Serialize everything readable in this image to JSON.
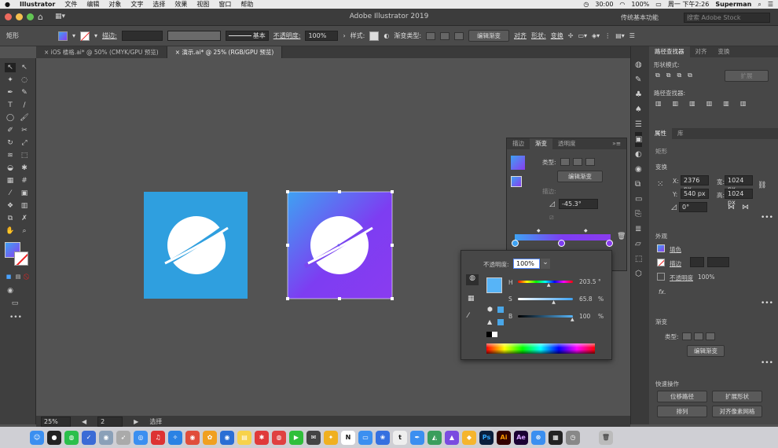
{
  "menubar": {
    "apple": "",
    "app": "Illustrator",
    "items": [
      "文件",
      "编辑",
      "对象",
      "文字",
      "选择",
      "效果",
      "视图",
      "窗口",
      "帮助"
    ],
    "battery": "100%",
    "time_status": "30:00",
    "datetime": "周一 下午2:26",
    "user": "Superman"
  },
  "appbar": {
    "title": "Adobe Illustrator 2019",
    "workspace": "传统基本功能",
    "search_placeholder": "搜索 Adobe Stock"
  },
  "control_bar": {
    "shape_name": "矩形",
    "stroke_label": "描边:",
    "stroke_style": "基本",
    "opacity_label": "不透明度:",
    "opacity_value": "100%",
    "style_label": "样式:",
    "gradient_type_label": "渐变类型:",
    "edit_gradient": "编辑渐变",
    "align": "对齐",
    "shape": "形状:",
    "transform": "变换"
  },
  "doc_tabs": [
    {
      "label": "iOS 楼格.ai* @ 50% (CMYK/GPU 预览)",
      "active": false
    },
    {
      "label": "演示.ai* @ 25% (RGB/GPU 预览)",
      "active": true
    }
  ],
  "status": {
    "zoom": "25%",
    "page": "2",
    "tool": "选择"
  },
  "gradient_panel": {
    "tabs": [
      "描边",
      "渐变",
      "透明度"
    ],
    "type_label": "类型:",
    "edit_button": "编辑渐变",
    "stroke_label": "描边:",
    "angle": "-45.3°"
  },
  "color_popup": {
    "opacity_label": "不透明度:",
    "opacity_value": "100%",
    "h_label": "H",
    "h_value": "203.5",
    "h_unit": "°",
    "h_fraction": 0.57,
    "s_label": "S",
    "s_value": "65.8",
    "s_unit": "%",
    "s_fraction": 0.66,
    "b_label": "B",
    "b_value": "100",
    "b_unit": "%",
    "b_fraction": 1.0,
    "swatch_color": "#57b4f7"
  },
  "right_panel": {
    "top_tabs": [
      "路径查找器",
      "对齐",
      "变换"
    ],
    "shape_modes": "形状模式:",
    "expand": "扩展",
    "pathfinder": "路径查找器:",
    "prop_tabs": [
      "属性",
      "库"
    ],
    "rect_label": "矩形",
    "transform_label": "变换",
    "x_label": "X:",
    "x_value": "2376 px",
    "w_label": "宽:",
    "w_value": "1024 px",
    "y_label": "Y:",
    "y_value": "540 px",
    "h_label": "高:",
    "h_value": "1024 px",
    "rotate_value": "0°",
    "appearance_label": "外观",
    "fill_label": "填色",
    "stroke_label": "描边",
    "opacity_label": "不透明度",
    "opacity_value": "100%",
    "fx": "fx.",
    "gradient_label": "渐变",
    "type_label": "类型:",
    "edit_gradient": "编辑渐变",
    "quick_actions": "快速操作",
    "offset_path": "位移路径",
    "expand_shape": "扩展形状",
    "arrange": "排列",
    "pixel_align": "对齐像素网格"
  },
  "colors": {
    "icon_blue": "#2f9fdf",
    "grad_start": "#3ea2f2",
    "grad_mid": "#7d3df2",
    "grad_end": "#8a3cf0"
  },
  "dock_icons": [
    "finder-icon",
    "qq-icon",
    "wechat-icon",
    "tasks-icon",
    "launchpad-icon",
    "rocket-icon",
    "chrome-icon",
    "netease-music-icon",
    "safari-icon",
    "google-chrome-icon",
    "photos-icon",
    "camera-icon",
    "notes-icon",
    "app-store-icon",
    "preview-icon",
    "iqiyi-icon",
    "mail-icon",
    "butterfly-icon",
    "notion-icon",
    "keynote-icon",
    "baidu-icon",
    "typora-icon",
    "pen-icon",
    "maps-icon",
    "affinity-icon",
    "sketch-icon",
    "photoshop-icon",
    "illustrator-icon",
    "after-effects-icon",
    "settings-icon",
    "activity-icon",
    "screenshot-icon",
    "trash-icon"
  ],
  "dock_labels": {
    "ps": "Ps",
    "ai": "Ai",
    "ae": "Ae",
    "t": "t",
    "n": "N"
  }
}
